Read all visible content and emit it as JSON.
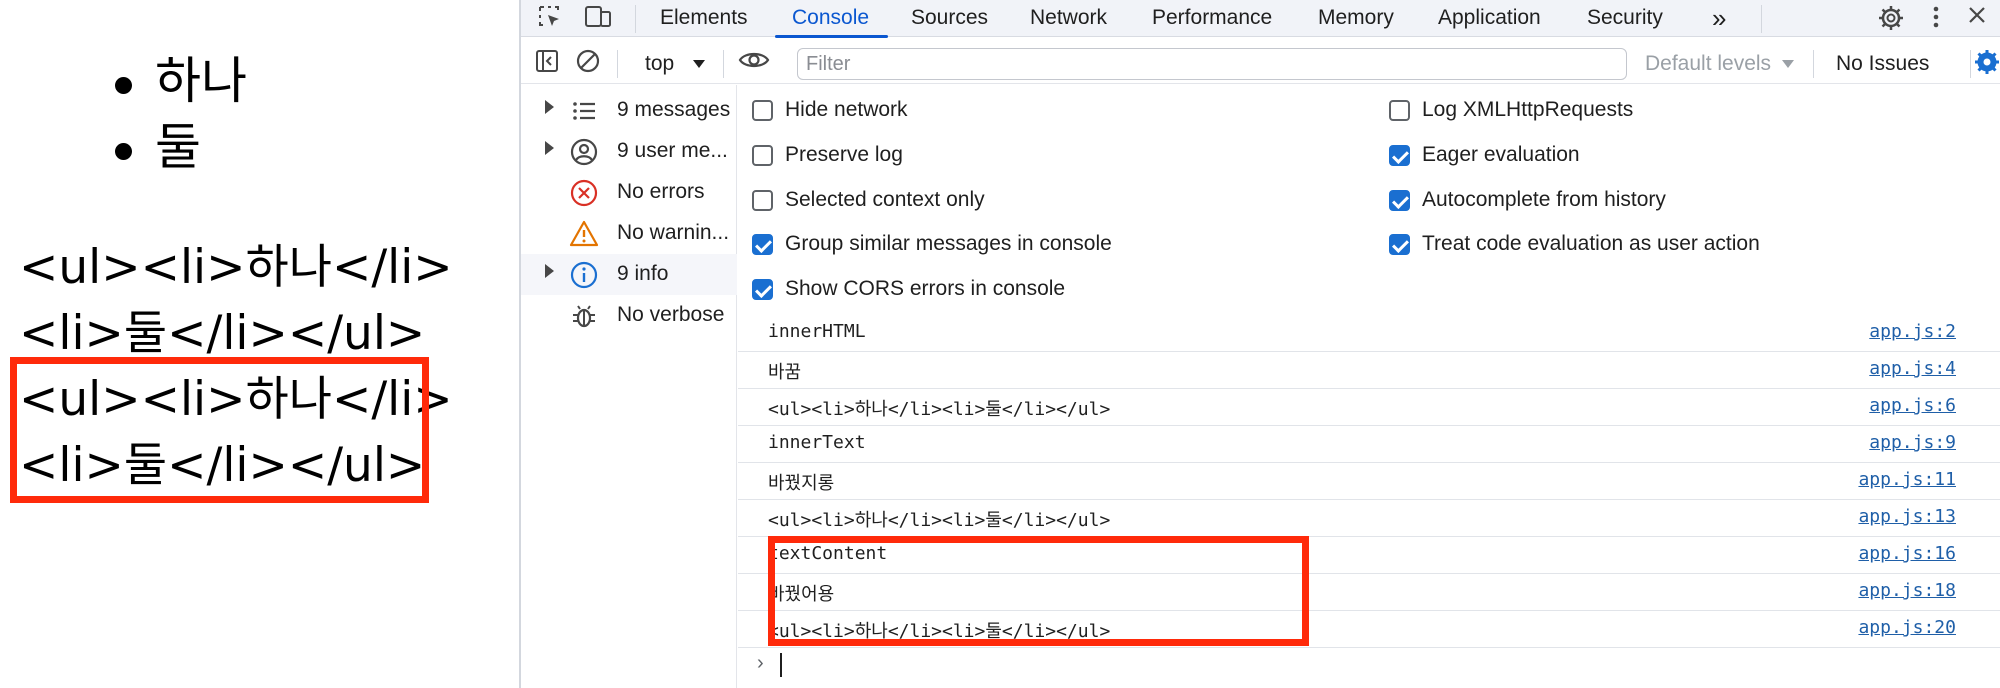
{
  "page": {
    "list_items": [
      "하나",
      "둘"
    ],
    "html_output_1": [
      "<ul><li>하나</li>",
      "<li>둘</li></ul>"
    ],
    "html_output_2": [
      "<ul><li>하나</li>",
      "<li>둘</li></ul>"
    ]
  },
  "devtools": {
    "tabs": [
      "Elements",
      "Console",
      "Sources",
      "Network",
      "Performance",
      "Memory",
      "Application",
      "Security"
    ],
    "active_tab": "Console",
    "more_tabs": "»",
    "context": "top",
    "filter_placeholder": "Filter",
    "levels": "Default levels",
    "issues": "No Issues",
    "sidebar": [
      {
        "label": "9 messages",
        "icon": "list-icon"
      },
      {
        "label": "9 user me...",
        "icon": "user-icon"
      },
      {
        "label": "No errors",
        "icon": "error-icon"
      },
      {
        "label": "No warnin...",
        "icon": "warning-icon"
      },
      {
        "label": "9 info",
        "icon": "info-icon"
      },
      {
        "label": "No verbose",
        "icon": "bug-icon"
      }
    ],
    "settings_left": [
      {
        "label": "Hide network",
        "checked": false
      },
      {
        "label": "Preserve log",
        "checked": false
      },
      {
        "label": "Selected context only",
        "checked": false
      },
      {
        "label": "Group similar messages in console",
        "checked": true
      },
      {
        "label": "Show CORS errors in console",
        "checked": true
      }
    ],
    "settings_right": [
      {
        "label": "Log XMLHttpRequests",
        "checked": false
      },
      {
        "label": "Eager evaluation",
        "checked": true
      },
      {
        "label": "Autocomplete from history",
        "checked": true
      },
      {
        "label": "Treat code evaluation as user action",
        "checked": true
      }
    ],
    "messages": [
      {
        "text": "innerHTML",
        "source": "app.js:2"
      },
      {
        "text": "바꿈",
        "source": "app.js:4"
      },
      {
        "text": "<ul><li>하나</li><li>둘</li></ul>",
        "source": "app.js:6"
      },
      {
        "text": "innerText",
        "source": "app.js:9"
      },
      {
        "text": "바꿨지롱",
        "source": "app.js:11"
      },
      {
        "text": "<ul><li>하나</li><li>둘</li></ul>",
        "source": "app.js:13"
      },
      {
        "text": "textContent",
        "source": "app.js:16"
      },
      {
        "text": "바꿨어용",
        "source": "app.js:18"
      },
      {
        "text": "<ul><li>하나</li><li>둘</li></ul>",
        "source": "app.js:20"
      }
    ],
    "prompt_glyph": "›",
    "colors": {
      "accent": "#0b57d0",
      "highlight": "#ff2a0a",
      "link": "#1f5fa8"
    }
  }
}
